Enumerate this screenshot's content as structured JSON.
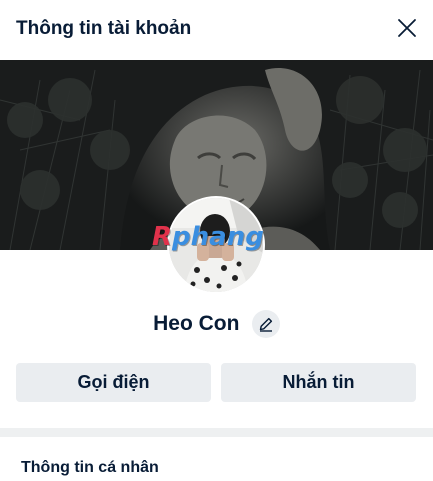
{
  "header": {
    "title": "Thông tin tài khoản",
    "close_icon": "close-icon"
  },
  "profile": {
    "name": "Heo Con",
    "edit_icon": "pencil-icon",
    "watermark": "Rphang"
  },
  "actions": {
    "call_label": "Gọi điện",
    "message_label": "Nhắn tin"
  },
  "section": {
    "title": "Thông tin cá nhân"
  },
  "colors": {
    "text": "#081c36",
    "button_bg": "#eaedf0",
    "divider": "#eef0f1",
    "watermark_blue": "#3a8ee0",
    "watermark_red": "#e0324b"
  }
}
